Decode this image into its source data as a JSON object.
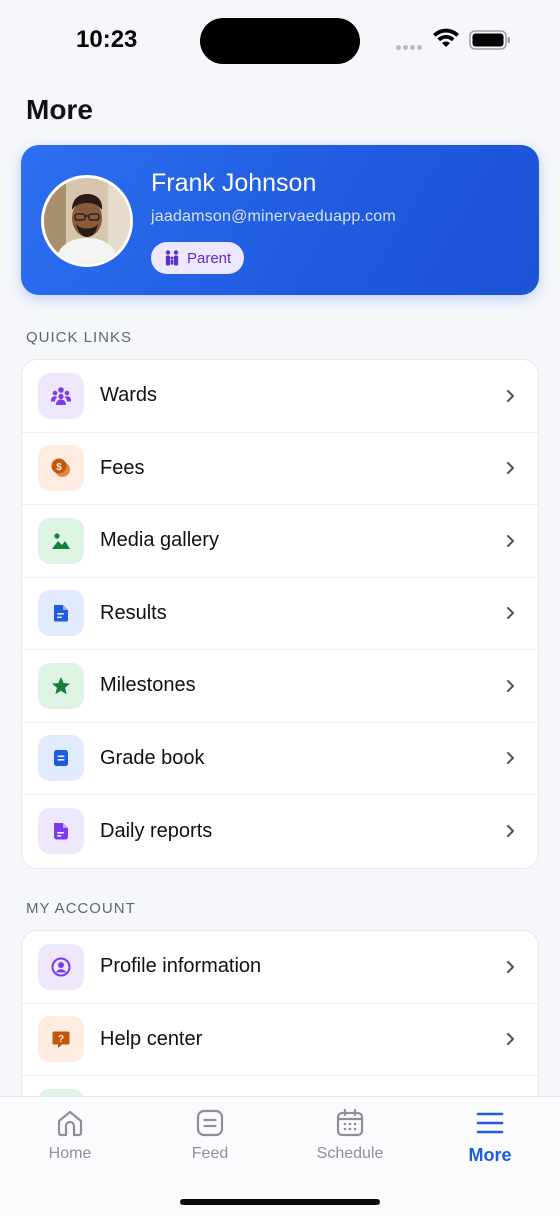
{
  "status_bar": {
    "time": "10:23"
  },
  "page": {
    "title": "More"
  },
  "profile": {
    "name": "Frank Johnson",
    "email": "jaadamson@minervaeduapp.com",
    "role": "Parent"
  },
  "quick_links": {
    "label": "QUICK LINKS",
    "items": [
      {
        "label": "Wards",
        "icon": "users-icon",
        "color": "#7c3aed",
        "bg": "#efe8fd"
      },
      {
        "label": "Fees",
        "icon": "coin-icon",
        "color": "#c2560c",
        "bg": "#fdecdf"
      },
      {
        "label": "Media gallery",
        "icon": "image-icon",
        "color": "#15803d",
        "bg": "#def5e6"
      },
      {
        "label": "Results",
        "icon": "document-icon",
        "color": "#1f5be0",
        "bg": "#e2eafd"
      },
      {
        "label": "Milestones",
        "icon": "star-icon",
        "color": "#15803d",
        "bg": "#def5e6"
      },
      {
        "label": "Grade book",
        "icon": "gradebook-icon",
        "color": "#1f5be0",
        "bg": "#e2eafd"
      },
      {
        "label": "Daily reports",
        "icon": "report-icon",
        "color": "#7c3aed",
        "bg": "#efe8fd"
      }
    ]
  },
  "my_account": {
    "label": "MY ACCOUNT",
    "items": [
      {
        "label": "Profile information",
        "icon": "user-circle-icon",
        "color": "#7c3aed",
        "bg": "#efe8fd"
      },
      {
        "label": "Help center",
        "icon": "help-icon",
        "color": "#c2560c",
        "bg": "#fdecdf"
      }
    ]
  },
  "bottom_nav": {
    "items": [
      {
        "label": "Home",
        "icon": "home-icon"
      },
      {
        "label": "Feed",
        "icon": "feed-icon"
      },
      {
        "label": "Schedule",
        "icon": "calendar-icon"
      },
      {
        "label": "More",
        "icon": "menu-icon",
        "active": true
      }
    ]
  }
}
